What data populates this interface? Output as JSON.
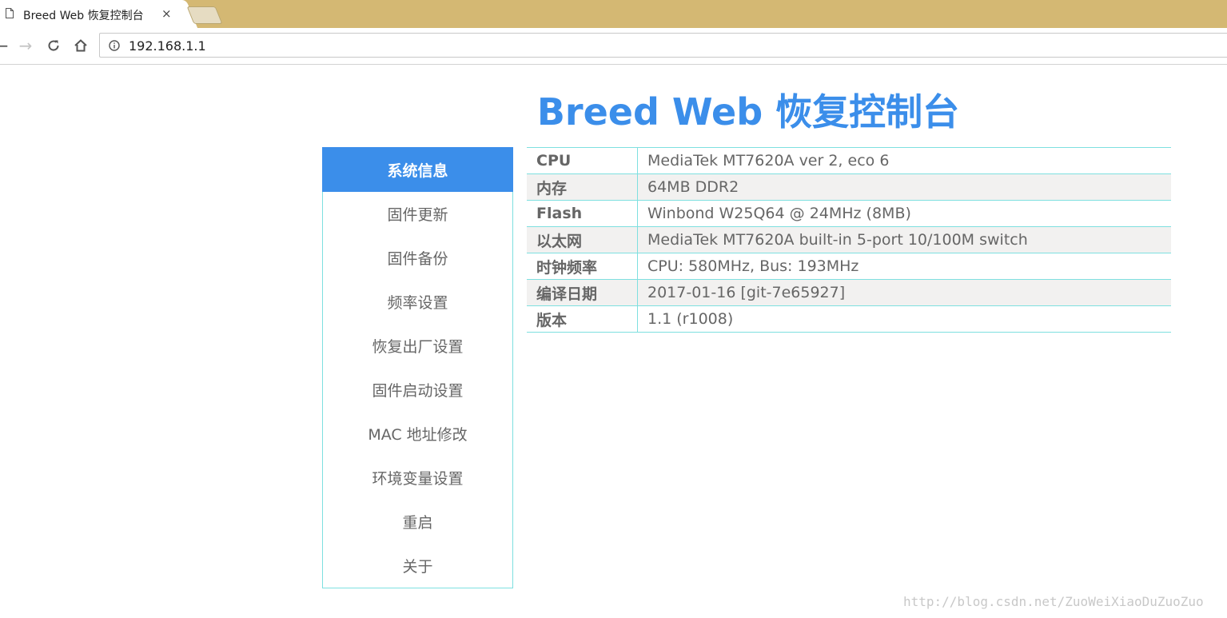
{
  "browser": {
    "tab_title": "Breed Web 恢复控制台",
    "close_glyph": "×",
    "url": "192.168.1.1",
    "back_glyph": "←",
    "forward_glyph": "→",
    "reload_glyph": "↻",
    "home_glyph": "⌂",
    "icons": [
      "document-icon",
      "close-icon",
      "back-icon",
      "forward-icon",
      "reload-icon",
      "home-icon",
      "info-icon"
    ]
  },
  "page": {
    "title": "Breed Web 恢复控制台"
  },
  "sidebar": {
    "items": [
      {
        "label": "系统信息",
        "active": true
      },
      {
        "label": "固件更新"
      },
      {
        "label": "固件备份"
      },
      {
        "label": "频率设置"
      },
      {
        "label": "恢复出厂设置"
      },
      {
        "label": "固件启动设置"
      },
      {
        "label": "MAC 地址修改"
      },
      {
        "label": "环境变量设置"
      },
      {
        "label": "重启"
      },
      {
        "label": "关于"
      }
    ]
  },
  "system_info": {
    "rows": [
      {
        "key": "CPU",
        "value": "MediaTek MT7620A ver 2, eco 6"
      },
      {
        "key": "内存",
        "value": "64MB DDR2"
      },
      {
        "key": "Flash",
        "value": "Winbond W25Q64 @ 24MHz (8MB)"
      },
      {
        "key": "以太网",
        "value": "MediaTek MT7620A built-in 5-port 10/100M switch"
      },
      {
        "key": "时钟频率",
        "value": "CPU: 580MHz, Bus: 193MHz"
      },
      {
        "key": "编译日期",
        "value": "2017-01-16 [git-7e65927]"
      },
      {
        "key": "版本",
        "value": "1.1 (r1008)"
      }
    ]
  },
  "watermark": "http://blog.csdn.net/ZuoWeiXiaoDuZuoZuo",
  "colors": {
    "accent": "#3b8eea",
    "border": "#7ee0e0",
    "tabbar": "#d4b873",
    "stripe": "#f2f1f0"
  }
}
